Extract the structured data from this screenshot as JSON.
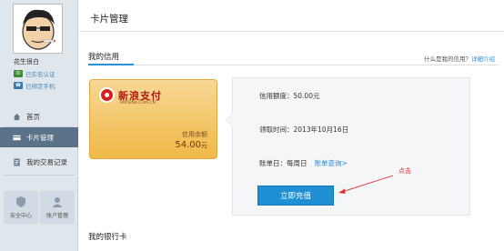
{
  "sidebar": {
    "username": "花生很白",
    "verifications": [
      "已实名认证",
      "已绑定手机"
    ],
    "nav": [
      {
        "label": "首页",
        "icon": "home-icon"
      },
      {
        "label": "卡片管理",
        "icon": "card-icon",
        "active": true
      },
      {
        "label": "我的交易记录",
        "icon": "record-icon"
      }
    ],
    "tiles": [
      {
        "label": "安全中心",
        "icon": "shield-icon"
      },
      {
        "label": "账户管理",
        "icon": "user-icon"
      }
    ]
  },
  "main": {
    "page_title": "卡片管理",
    "credit_section": {
      "title": "我的信用",
      "help_text": "什么是我的信用？",
      "help_link": "详细介绍"
    },
    "card": {
      "brand": "新浪支付",
      "brand_sub": "PAY.SINA.COM.CN",
      "balance_label": "信用余额",
      "balance_amount": "54.00",
      "balance_unit": "元"
    },
    "info": {
      "limit_label": "信用额度：",
      "limit_value": "50.00元",
      "claim_label": "领取时间：",
      "claim_value": "2013年10月16日",
      "bill_label": "账单日：",
      "bill_value": "每周日",
      "bill_link": "账单查询>",
      "recharge_button": "立即充值"
    },
    "annotation": "点击",
    "bank_section": {
      "title": "我的银行卡"
    }
  },
  "colors": {
    "accent": "#1e8fd3",
    "sidebar_bg": "#dfe6ec",
    "active_nav": "#5a7288",
    "card_gold": "#f3c465",
    "annotation_red": "#e03030"
  }
}
